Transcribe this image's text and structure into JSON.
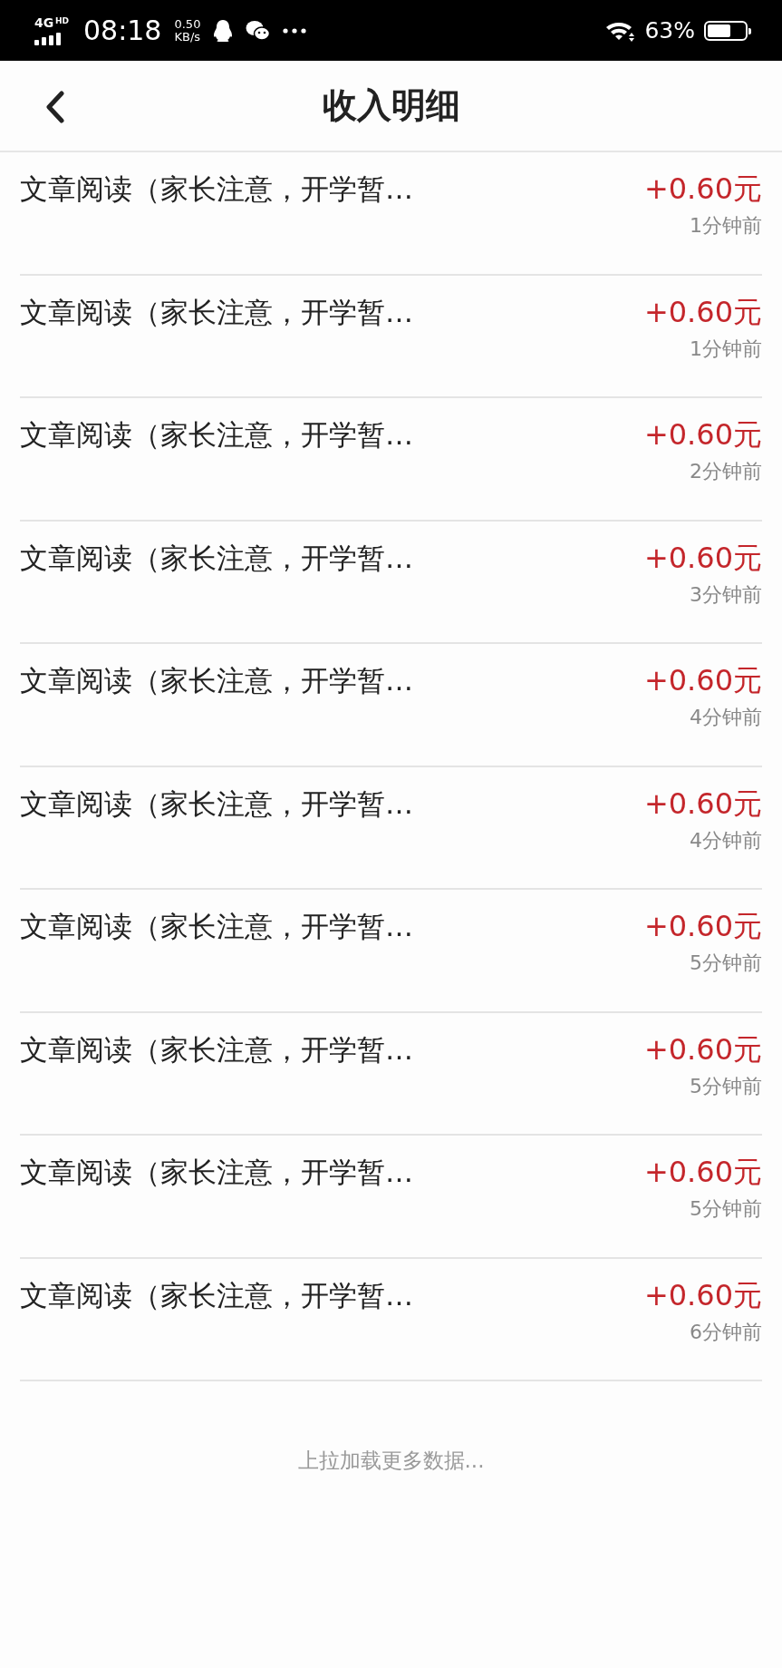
{
  "status_bar": {
    "network": "4G",
    "network_badge": "HD",
    "time": "08:18",
    "speed": "0.50",
    "speed_unit": "KB/s",
    "battery": "63%"
  },
  "header": {
    "title": "收入明细"
  },
  "items": [
    {
      "title": "文章阅读（家长注意，开学暂…",
      "amount": "+0.60元",
      "time": "1分钟前"
    },
    {
      "title": "文章阅读（家长注意，开学暂…",
      "amount": "+0.60元",
      "time": "1分钟前"
    },
    {
      "title": "文章阅读（家长注意，开学暂…",
      "amount": "+0.60元",
      "time": "2分钟前"
    },
    {
      "title": "文章阅读（家长注意，开学暂…",
      "amount": "+0.60元",
      "time": "3分钟前"
    },
    {
      "title": "文章阅读（家长注意，开学暂…",
      "amount": "+0.60元",
      "time": "4分钟前"
    },
    {
      "title": "文章阅读（家长注意，开学暂…",
      "amount": "+0.60元",
      "time": "4分钟前"
    },
    {
      "title": "文章阅读（家长注意，开学暂…",
      "amount": "+0.60元",
      "time": "5分钟前"
    },
    {
      "title": "文章阅读（家长注意，开学暂…",
      "amount": "+0.60元",
      "time": "5分钟前"
    },
    {
      "title": "文章阅读（家长注意，开学暂…",
      "amount": "+0.60元",
      "time": "5分钟前"
    },
    {
      "title": "文章阅读（家长注意，开学暂…",
      "amount": "+0.60元",
      "time": "6分钟前"
    }
  ],
  "footer": {
    "load_more": "上拉加载更多数据..."
  }
}
